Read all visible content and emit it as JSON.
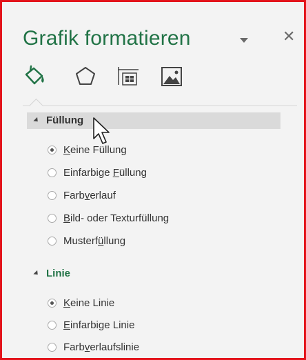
{
  "pane": {
    "title": "Grafik formatieren",
    "title_color": "#217346",
    "close_symbol": "✕",
    "icons": {
      "dropdown": "chevron-down-icon",
      "close": "close-icon"
    }
  },
  "tabs": [
    {
      "name": "fill-line-tab",
      "icon": "paint-bucket-icon",
      "selected": true
    },
    {
      "name": "effects-tab",
      "icon": "pentagon-icon",
      "selected": false
    },
    {
      "name": "size-properties-tab",
      "icon": "size-properties-icon",
      "selected": false
    },
    {
      "name": "picture-tab",
      "icon": "picture-icon",
      "selected": false
    }
  ],
  "sections": {
    "fill": {
      "label": "Füllung",
      "label_color": "#333333",
      "hovered": true,
      "options": [
        {
          "pre": "",
          "u": "K",
          "post": "eine Füllung",
          "checked": true
        },
        {
          "pre": "Einfarbige ",
          "u": "F",
          "post": "üllung",
          "checked": false
        },
        {
          "pre": "Farb",
          "u": "v",
          "post": "erlauf",
          "checked": false
        },
        {
          "pre": "",
          "u": "B",
          "post": "ild- oder Texturfüllung",
          "checked": false
        },
        {
          "pre": "Musterf",
          "u": "ü",
          "post": "llung",
          "checked": false
        }
      ]
    },
    "line": {
      "label": "Linie",
      "label_color": "#217346",
      "hovered": false,
      "options": [
        {
          "pre": "",
          "u": "K",
          "post": "eine Linie",
          "checked": true
        },
        {
          "pre": "",
          "u": "E",
          "post": "infarbige Linie",
          "checked": false
        },
        {
          "pre": "Farb",
          "u": "v",
          "post": "erlaufslinie",
          "checked": false
        }
      ]
    }
  },
  "colors": {
    "accent_green": "#217346",
    "frame_red": "#e3141b",
    "panel_bg": "#f3f3f3",
    "hover_bg": "#dadada"
  },
  "cursor_icon": "mouse-pointer-icon"
}
